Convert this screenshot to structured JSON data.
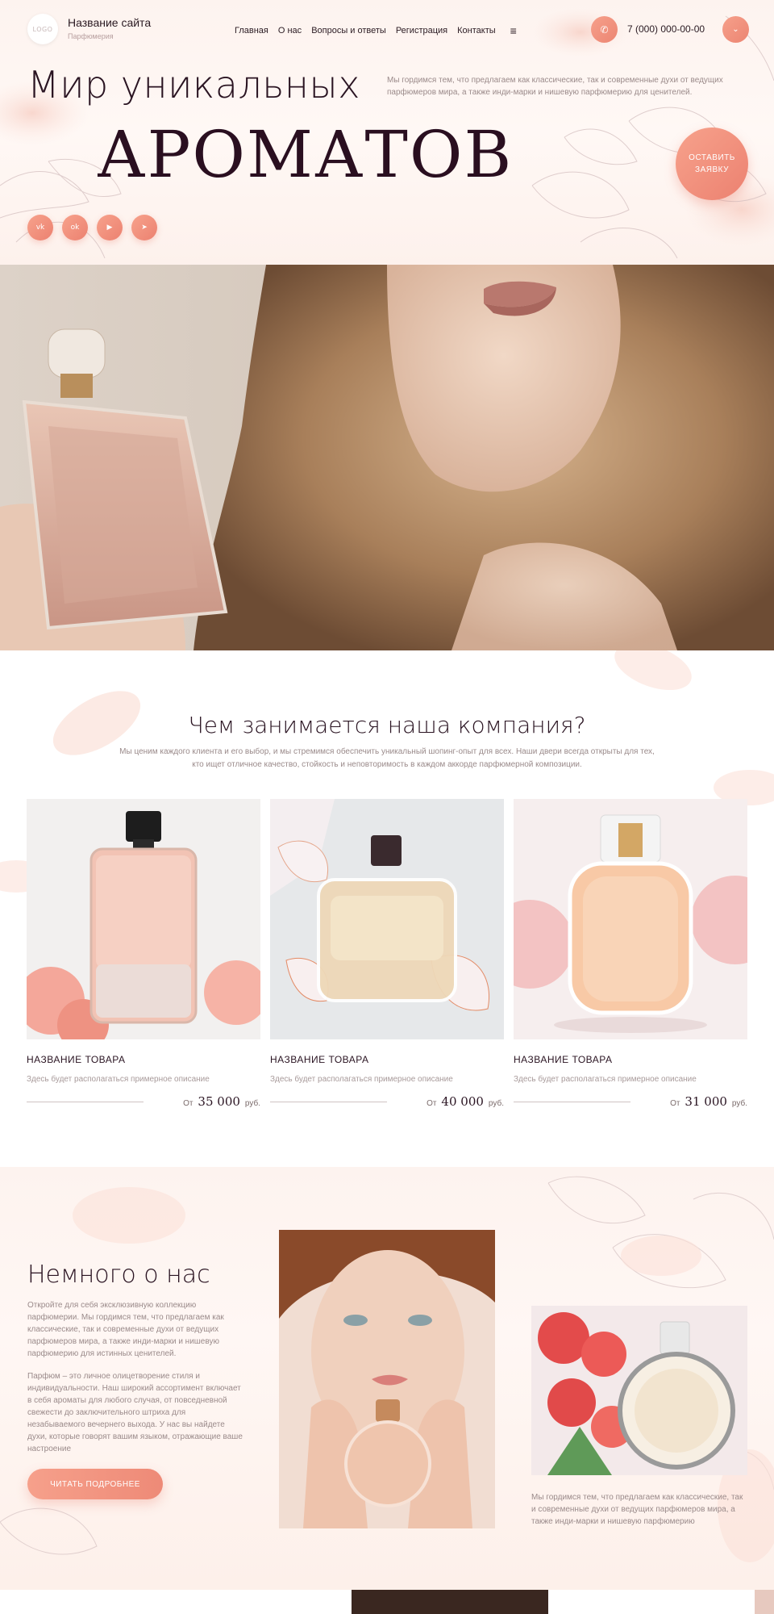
{
  "header": {
    "logo": "LOGO",
    "site_name": "Название сайта",
    "site_sub": "Парфюмерия",
    "nav": [
      "Главная",
      "О нас",
      "Вопросы и ответы",
      "Регистрация",
      "Контакты"
    ],
    "menu_icon": "≡",
    "phone": "7 (000) 000-00-00"
  },
  "hero": {
    "title_line1": "Мир уникальных",
    "title_line2": "АРОМАТОВ",
    "description": "Мы гордимся тем, что предлагаем как классические, так и современные духи от ведущих парфюмеров мира, а также инди-марки и нишевую парфюмерию для ценителей.",
    "cta_line1": "ОСТАВИТЬ",
    "cta_line2": "ЗАЯВКУ",
    "socials": [
      "vk",
      "ok",
      "yt",
      "tg"
    ]
  },
  "services": {
    "title": "Чем занимается наша компания?",
    "description_line1": "Мы ценим каждого клиента и его выбор, и мы стремимся обеспечить уникальный шопинг-опыт для всех. Наши двери всегда открыты для тех,",
    "description_line2": "кто ищет отличное качество, стойкость и неповторимость в каждом аккорде парфюмерной композиции.",
    "products": [
      {
        "name": "НАЗВАНИЕ ТОВАРА",
        "desc": "Здесь будет располагаться примерное описание",
        "price_prefix": "От",
        "price": "35 000",
        "currency": "руб."
      },
      {
        "name": "НАЗВАНИЕ ТОВАРА",
        "desc": "Здесь будет располагаться примерное описание",
        "price_prefix": "От",
        "price": "40 000",
        "currency": "руб."
      },
      {
        "name": "НАЗВАНИЕ ТОВАРА",
        "desc": "Здесь будет располагаться примерное описание",
        "price_prefix": "От",
        "price": "31 000",
        "currency": "руб."
      }
    ]
  },
  "about": {
    "title": "Немного о нас",
    "p1": "Откройте для себя эксклюзивную коллекцию парфюмерии. Мы гордимся тем, что предлагаем как классические, так и современные духи от ведущих парфюмеров мира, а также инди-марки и нишевую парфюмерию для истинных ценителей.",
    "p2": "Парфюм – это личное олицетворение стиля и индивидуальности. Наш широкий ассортимент включает в себя ароматы для любого случая, от повседневной свежести до заключительного штриха для незабываемого вечернего выхода. У нас вы найдете духи, которые говорят вашим языком, отражающие ваше настроение",
    "button": "ЧИТАТЬ ПОДРОБНЕЕ",
    "caption": "Мы гордимся тем, что предлагаем как классические, так и современные духи от ведущих парфюмеров мира, а также инди-марки и нишевую парфюмерию"
  },
  "colors": {
    "accent": "#ee8a77",
    "accent_light": "#f7a28c",
    "text_dark": "#2a1422",
    "text_muted": "#9a8a8a"
  }
}
